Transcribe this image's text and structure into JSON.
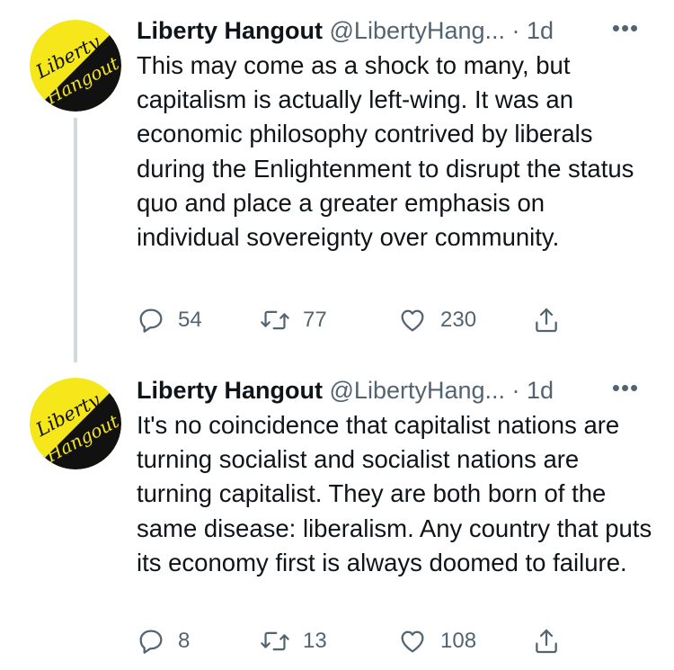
{
  "colors": {
    "text_primary": "#0f1419",
    "text_secondary": "#536471",
    "thread_line": "#cfd9de",
    "avatar_yellow": "#f5e71a",
    "avatar_black": "#111111"
  },
  "tweets": [
    {
      "author": {
        "name": "Liberty Hangout",
        "handle": "@LibertyHang...",
        "avatar_text_top": "Liberty",
        "avatar_text_bottom": "Hangout"
      },
      "separator": " · ",
      "time": "1d",
      "more_label": "•••",
      "text": "This may come as a shock to many, but capitalism is actually left-wing. It was an economic philosophy contrived by liberals during the Enlightenment to disrupt the status quo and place a greater emphasis on individual sovereignty over community.",
      "stats": {
        "replies": "54",
        "retweets": "77",
        "likes": "230"
      },
      "icons": {
        "reply": "reply-icon",
        "retweet": "retweet-icon",
        "like": "heart-icon",
        "share": "share-icon"
      }
    },
    {
      "author": {
        "name": "Liberty Hangout",
        "handle": "@LibertyHang...",
        "avatar_text_top": "Liberty",
        "avatar_text_bottom": "Hangout"
      },
      "separator": " · ",
      "time": "1d",
      "more_label": "•••",
      "text": "It's no coincidence that capitalist nations are turning socialist and socialist nations are turning capitalist. They are both born of the same disease: liberalism. Any country that puts its economy first is always doomed to failure.",
      "stats": {
        "replies": "8",
        "retweets": "13",
        "likes": "108"
      },
      "icons": {
        "reply": "reply-icon",
        "retweet": "retweet-icon",
        "like": "heart-icon",
        "share": "share-icon"
      }
    }
  ]
}
